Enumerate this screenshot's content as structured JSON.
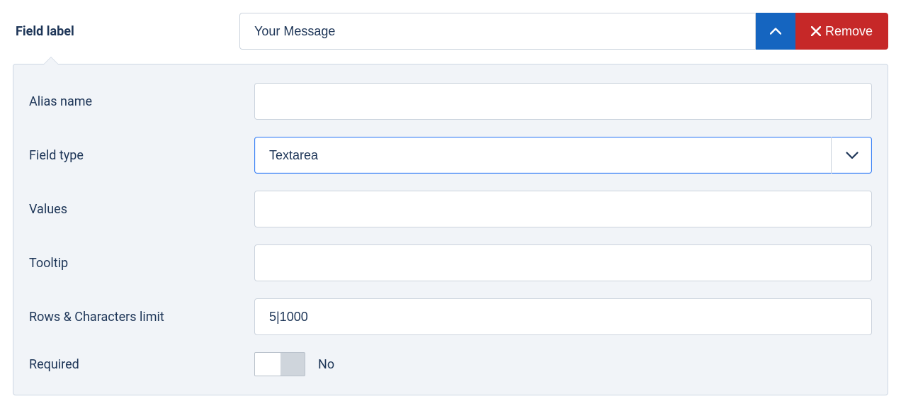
{
  "header": {
    "field_label": "Field label",
    "field_label_value": "Your Message",
    "remove_label": "Remove"
  },
  "panel": {
    "alias_name": {
      "label": "Alias name",
      "value": ""
    },
    "field_type": {
      "label": "Field type",
      "value": "Textarea"
    },
    "values": {
      "label": "Values",
      "value": ""
    },
    "tooltip": {
      "label": "Tooltip",
      "value": ""
    },
    "rows_chars": {
      "label": "Rows & Characters limit",
      "value": "5|1000"
    },
    "required": {
      "label": "Required",
      "state": "No"
    }
  }
}
